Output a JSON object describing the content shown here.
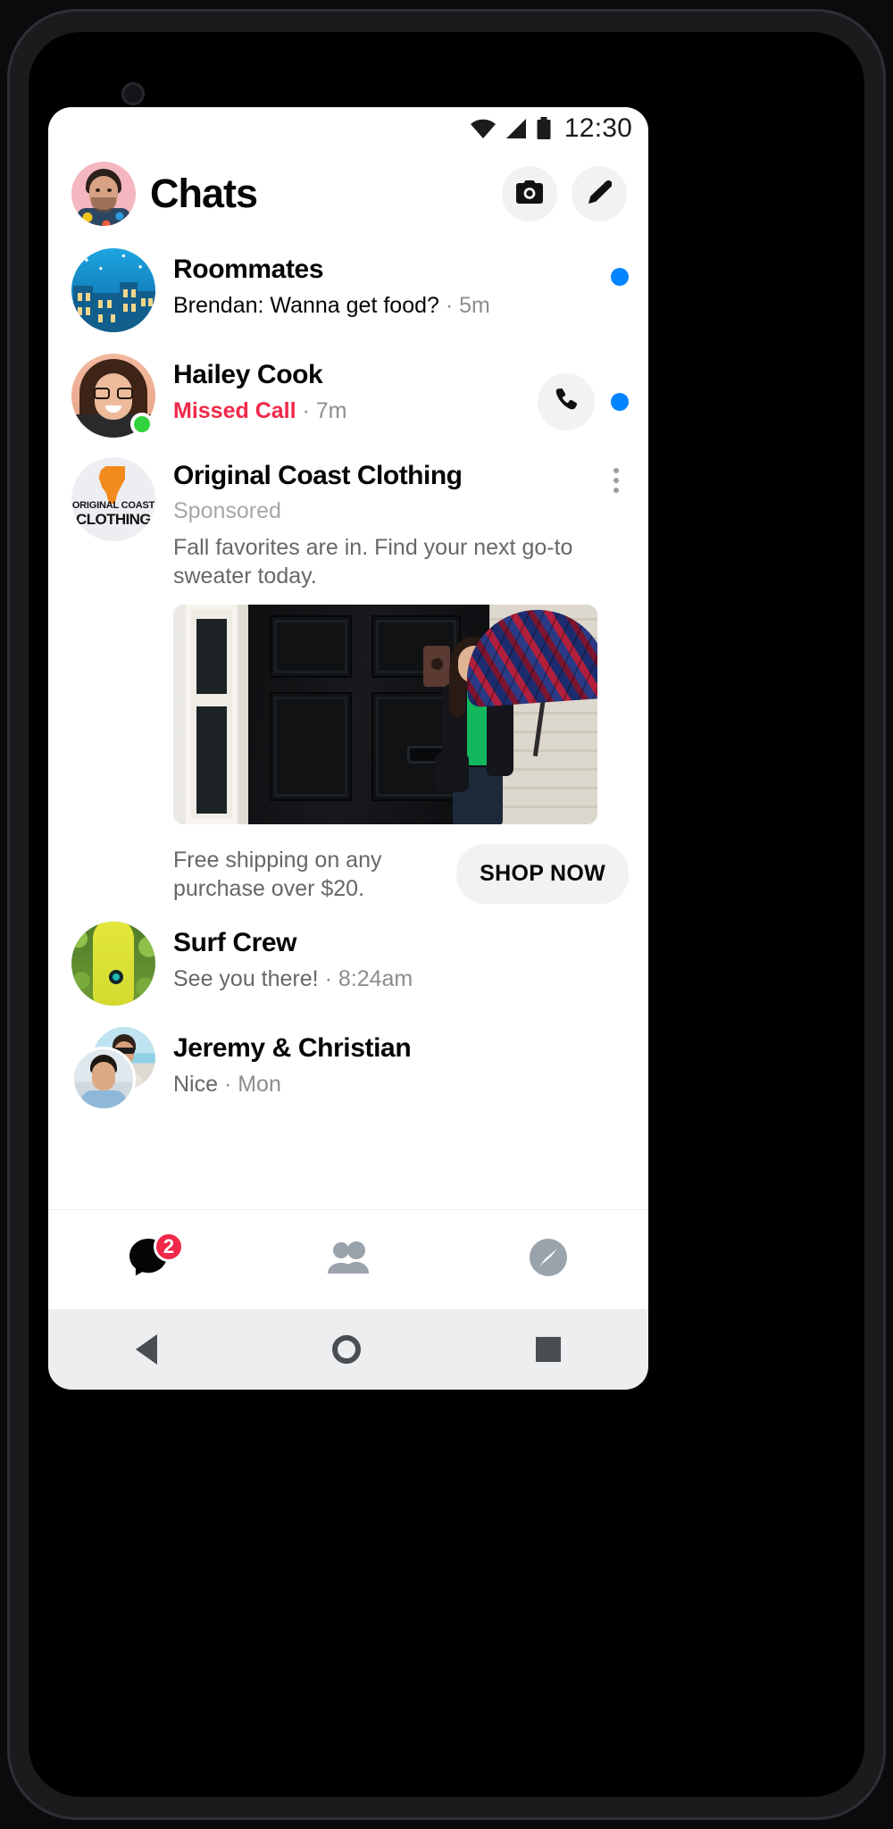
{
  "status_bar": {
    "time": "12:30",
    "icons": [
      "wifi-icon",
      "cellular-signal-icon",
      "battery-icon"
    ]
  },
  "header": {
    "title": "Chats",
    "avatar_name": "user-avatar",
    "camera_label": "camera-icon",
    "compose_label": "compose-icon"
  },
  "chats": [
    {
      "name": "Roommates",
      "snippet": "Brendan: Wanna get food?",
      "separator": " · ",
      "time": "5m",
      "unread": true,
      "has_call_button": false,
      "online": false,
      "missed_call": false
    },
    {
      "name": "Hailey Cook",
      "snippet": "Missed Call",
      "separator": " · ",
      "time": "7m",
      "unread": true,
      "has_call_button": true,
      "online": true,
      "missed_call": true
    },
    {
      "name": "Surf Crew",
      "snippet": "See you there!",
      "separator": " · ",
      "time": "8:24am",
      "unread": false,
      "has_call_button": false,
      "online": false,
      "missed_call": false
    },
    {
      "name": "Jeremy & Christian",
      "snippet": "Nice",
      "separator": " · ",
      "time": "Mon",
      "unread": false,
      "has_call_button": false,
      "online": false,
      "missed_call": false
    }
  ],
  "ad": {
    "title": "Original Coast Clothing",
    "sponsored_label": "Sponsored",
    "copy": "Fall favorites are in. Find your next go-to sweater today.",
    "cta_text": "Free shipping on any purchase over $20.",
    "cta_button": "SHOP NOW",
    "logo_line1": "ORIGINAL COAST",
    "logo_line2": "CLOTHING",
    "menu_label": "ad-options-icon",
    "image_alt": "woman-with-plaid-umbrella-by-black-door"
  },
  "bottom_nav": [
    {
      "name": "chats-tab",
      "icon": "chat-bubble-icon",
      "active": true,
      "badge": "2"
    },
    {
      "name": "people-tab",
      "icon": "people-icon",
      "active": false,
      "badge": ""
    },
    {
      "name": "discover-tab",
      "icon": "compass-icon",
      "active": false,
      "badge": ""
    }
  ],
  "android_nav": [
    {
      "name": "back-button",
      "icon": "triangle-back-icon"
    },
    {
      "name": "home-button",
      "icon": "circle-home-icon"
    },
    {
      "name": "recents-button",
      "icon": "square-recents-icon"
    }
  ],
  "colors": {
    "accent_blue": "#0084ff",
    "missed_red": "#f02849",
    "online_green": "#31d43d",
    "badge_red": "#f02849",
    "logo_orange": "#f28a1d"
  }
}
